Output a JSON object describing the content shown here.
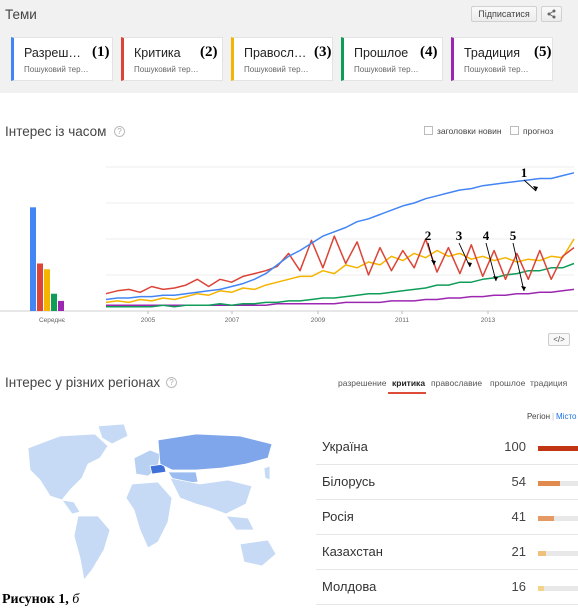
{
  "header": {
    "title": "Теми",
    "subscribe_label": "Підписатися",
    "share_icon": "share-icon"
  },
  "topics": [
    {
      "label": "Разреш…",
      "num": "(1)",
      "sub": "Пошуковий тер…",
      "color": "#4285f4"
    },
    {
      "label": "Критика",
      "num": "(2)",
      "sub": "Пошуковий тер…",
      "color": "#db4437"
    },
    {
      "label": "Правосл…",
      "num": "(3)",
      "sub": "Пошуковий тер…",
      "color": "#f4b400"
    },
    {
      "label": "Прошлое",
      "num": "(4)",
      "sub": "Пошуковий тер…",
      "color": "#0f9d58"
    },
    {
      "label": "Традиция",
      "num": "(5)",
      "sub": "Пошуковий тер…",
      "color": "#9c27b0"
    }
  ],
  "interest_time": {
    "title": "Інтерес із часом",
    "news_headlines_label": "заголовки новин",
    "forecast_label": "прогноз",
    "average_label": "Середнє",
    "embed_label": "</>"
  },
  "chart_data": {
    "type": "line",
    "x_ticks": [
      "2005",
      "2007",
      "2009",
      "2011",
      "2013"
    ],
    "annotations": [
      "1",
      "2",
      "3",
      "4",
      "5"
    ],
    "average_bars": [
      {
        "series": "Разреш…",
        "value": 72,
        "color": "#4285f4"
      },
      {
        "series": "Критика",
        "value": 33,
        "color": "#db4437"
      },
      {
        "series": "Правосл…",
        "value": 29,
        "color": "#f4b400"
      },
      {
        "series": "Прошлое",
        "value": 12,
        "color": "#0f9d58"
      },
      {
        "series": "Традиция",
        "value": 7,
        "color": "#9c27b0"
      }
    ],
    "series": [
      {
        "name": "Разреш…",
        "color": "#4285f4",
        "values": [
          8,
          9,
          9,
          10,
          10,
          11,
          11,
          12,
          13,
          14,
          15,
          17,
          19,
          22,
          26,
          32,
          38,
          42,
          47,
          52,
          55,
          58,
          62,
          64,
          67,
          70,
          73,
          75,
          78,
          80,
          82,
          84,
          85,
          87,
          88,
          89,
          90,
          91,
          92,
          92,
          94,
          96
        ]
      },
      {
        "name": "Критика",
        "color": "#db4437",
        "values": [
          12,
          14,
          15,
          13,
          17,
          15,
          16,
          18,
          22,
          17,
          22,
          20,
          24,
          26,
          28,
          31,
          40,
          28,
          49,
          30,
          52,
          33,
          48,
          25,
          44,
          28,
          42,
          30,
          50,
          27,
          44,
          26,
          46,
          24,
          42,
          22,
          40,
          22,
          42,
          22,
          38,
          44
        ]
      },
      {
        "name": "Правосл…",
        "color": "#f4b400",
        "values": [
          6,
          7,
          6,
          8,
          7,
          9,
          8,
          10,
          12,
          11,
          14,
          13,
          16,
          15,
          18,
          20,
          22,
          24,
          24,
          28,
          26,
          32,
          30,
          34,
          32,
          38,
          35,
          40,
          37,
          42,
          38,
          40,
          36,
          38,
          35,
          37,
          34,
          36,
          35,
          38,
          37,
          50
        ]
      },
      {
        "name": "Прошлое",
        "color": "#0f9d58",
        "values": [
          3,
          3,
          3,
          3,
          3,
          4,
          3,
          4,
          4,
          4,
          5,
          4,
          5,
          5,
          6,
          6,
          7,
          7,
          8,
          9,
          9,
          10,
          11,
          12,
          12,
          13,
          14,
          15,
          16,
          18,
          18,
          20,
          20,
          22,
          23,
          25,
          26,
          28,
          28,
          30,
          30,
          33
        ]
      },
      {
        "name": "Традиция",
        "color": "#9c27b0",
        "values": [
          4,
          4,
          4,
          4,
          4,
          4,
          4,
          4,
          4,
          4,
          4,
          4,
          4,
          4,
          4,
          5,
          5,
          5,
          5,
          5,
          5,
          6,
          6,
          6,
          6,
          7,
          7,
          7,
          8,
          8,
          9,
          9,
          10,
          10,
          11,
          11,
          12,
          12,
          13,
          13,
          14,
          15
        ]
      }
    ]
  },
  "regions": {
    "title": "Інтерес у різних регіонах",
    "tabs": [
      "разрешение",
      "критика",
      "православие",
      "прошлое",
      "традиция"
    ],
    "active_tab": 1,
    "region_label": "Регіон",
    "city_label": "Місто",
    "rows": [
      {
        "country": "Україна",
        "value": "100",
        "pct": 1.0,
        "color": "#c13515"
      },
      {
        "country": "Білорусь",
        "value": "54",
        "pct": 0.54,
        "color": "#e08a4e"
      },
      {
        "country": "Росія",
        "value": "41",
        "pct": 0.41,
        "color": "#e59a64"
      },
      {
        "country": "Казахстан",
        "value": "21",
        "pct": 0.21,
        "color": "#efc17a"
      },
      {
        "country": "Молдова",
        "value": "16",
        "pct": 0.16,
        "color": "#f3d38a"
      }
    ]
  },
  "caption": {
    "text": "Рисунок 1,",
    "suffix": "б"
  }
}
